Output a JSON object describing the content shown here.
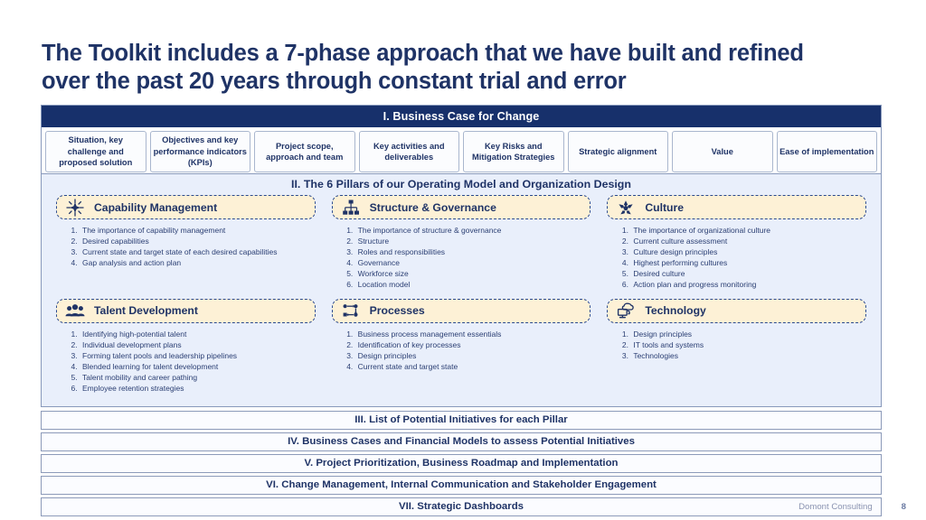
{
  "slide": {
    "title": "The Toolkit includes a 7-phase approach that we have built and refined over the past 20 years through constant trial and error"
  },
  "section_one": {
    "header": "I. Business Case for Change",
    "phases": [
      "Situation, key challenge and proposed solution",
      "Objectives and key performance indicators (KPIs)",
      "Project scope, approach and team",
      "Key activities and deliverables",
      "Key Risks and Mitigation Strategies",
      "Strategic alignment",
      "Value",
      "Ease of implementation"
    ]
  },
  "section_two": {
    "header": "II. The 6 Pillars of our Operating Model and Organization Design",
    "pillars": [
      {
        "title": "Capability Management",
        "icon": "starburst-icon",
        "items": [
          "The importance of capability management",
          "Desired capabilities",
          "Current state and target state of each desired capabilities",
          "Gap analysis and action plan"
        ]
      },
      {
        "title": "Structure & Governance",
        "icon": "org-chart-icon",
        "items": [
          "The importance of structure & governance",
          "Structure",
          "Roles and responsibilities",
          "Governance",
          "Workforce size",
          "Location model"
        ]
      },
      {
        "title": "Culture",
        "icon": "people-star-icon",
        "items": [
          "The importance of organizational culture",
          "Current culture assessment",
          "Culture design principles",
          "Highest performing cultures",
          "Desired culture",
          "Action plan and progress monitoring"
        ]
      },
      {
        "title": "Talent Development",
        "icon": "three-people-icon",
        "items": [
          "Identifying high-potential talent",
          "Individual development plans",
          "Forming talent pools and leadership pipelines",
          "Blended learning for talent development",
          "Talent mobility and career pathing",
          "Employee retention strategies"
        ]
      },
      {
        "title": "Processes",
        "icon": "process-flow-icon",
        "items": [
          "Business process management essentials",
          "Identification of key processes",
          "Design principles",
          "Current state and target state"
        ]
      },
      {
        "title": "Technology",
        "icon": "cloud-monitor-icon",
        "items": [
          "Design principles",
          "IT tools and systems",
          "Technologies"
        ]
      }
    ]
  },
  "bottom_sections": [
    "III. List of Potential Initiatives for each Pillar",
    "IV. Business Cases and Financial Models to assess Potential Initiatives",
    "V. Project Prioritization, Business Roadmap and Implementation",
    "VI. Change Management, Internal Communication and Stakeholder Engagement",
    "VII. Strategic Dashboards"
  ],
  "footer": {
    "company": "Domont Consulting",
    "page_number": "8"
  },
  "colors": {
    "navy": "#17306b",
    "title_blue": "#1f3366",
    "panel_blue": "#e9effb",
    "pillar_cream": "#fdf1d6",
    "dashed_border": "#2b4a8f"
  }
}
